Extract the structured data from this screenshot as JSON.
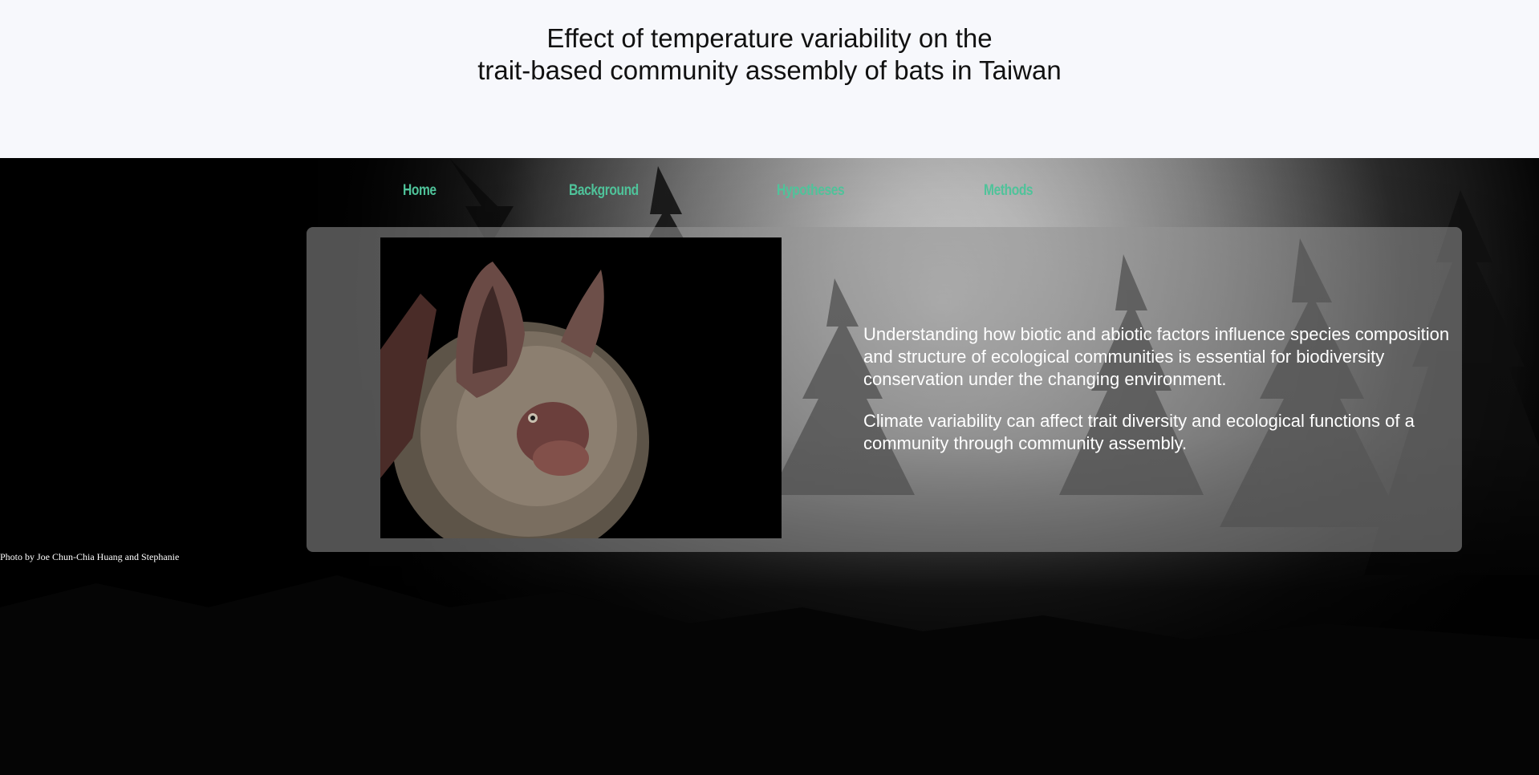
{
  "header": {
    "title_line1": "Effect of temperature variability on the",
    "title_line2": "trait-based community assembly of bats in Taiwan"
  },
  "nav": {
    "items": [
      {
        "label": "Home"
      },
      {
        "label": "Background"
      },
      {
        "label": "Hypotheses"
      },
      {
        "label": "Methods"
      }
    ]
  },
  "intro": {
    "paragraph1": "Understanding how biotic and abiotic factors influence species composition and structure of ecological communities is essential for biodiversity conservation under the changing environment.",
    "paragraph2": "Climate variability can affect trait diversity and ecological functions of a community through community assembly."
  },
  "photo_credit": "Photo by Joe Chun-Chia Huang and Stephanie",
  "colors": {
    "nav_link": "#4fc39a",
    "header_bg": "#f7f8fc",
    "panel_bg": "rgba(150,150,150,0.55)"
  }
}
